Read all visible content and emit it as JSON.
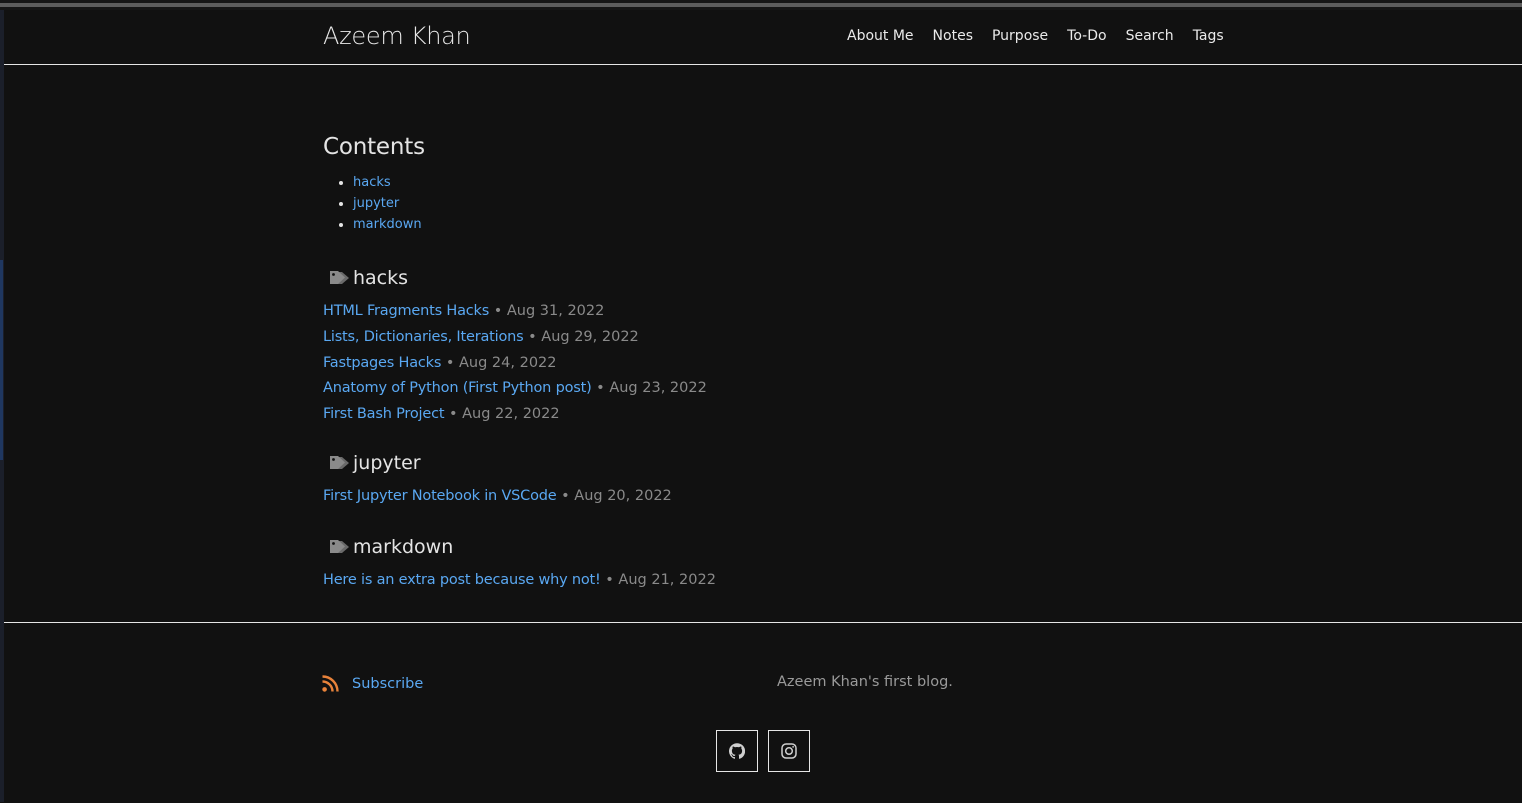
{
  "site": {
    "title": "Azeem Khan"
  },
  "nav": {
    "items": [
      {
        "label": "About Me"
      },
      {
        "label": "Notes"
      },
      {
        "label": "Purpose"
      },
      {
        "label": "To-Do"
      },
      {
        "label": "Search"
      },
      {
        "label": "Tags"
      }
    ]
  },
  "contents": {
    "title": "Contents",
    "items": [
      {
        "label": "hacks"
      },
      {
        "label": "jupyter"
      },
      {
        "label": "markdown"
      }
    ]
  },
  "tags": [
    {
      "name": "hacks",
      "posts": [
        {
          "title": "HTML Fragments Hacks",
          "date": "• Aug 31, 2022"
        },
        {
          "title": "Lists, Dictionaries, Iterations",
          "date": "• Aug 29, 2022"
        },
        {
          "title": "Fastpages Hacks",
          "date": "• Aug 24, 2022"
        },
        {
          "title": "Anatomy of Python (First Python post)",
          "date": "• Aug 23, 2022"
        },
        {
          "title": "First Bash Project",
          "date": "• Aug 22, 2022"
        }
      ]
    },
    {
      "name": "jupyter",
      "posts": [
        {
          "title": "First Jupyter Notebook in VSCode",
          "date": "• Aug 20, 2022"
        }
      ]
    },
    {
      "name": "markdown",
      "posts": [
        {
          "title": "Here is an extra post because why not!",
          "date": "• Aug 21, 2022"
        }
      ]
    }
  ],
  "footer": {
    "subscribe_label": "Subscribe",
    "description": "Azeem Khan's first blog.",
    "social": [
      {
        "icon": "github-icon"
      },
      {
        "icon": "instagram-icon"
      }
    ]
  },
  "colors": {
    "background": "#111111",
    "link": "#5aa8f2",
    "meta": "#8a8a8a",
    "rss": "#e8823a"
  }
}
